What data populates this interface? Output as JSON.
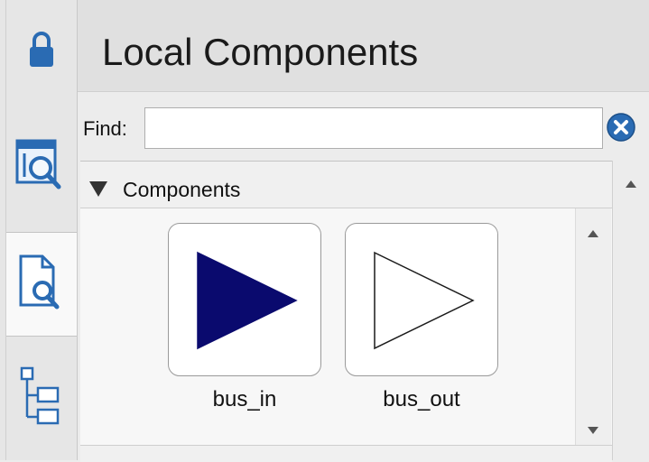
{
  "panel": {
    "title": "Local Components"
  },
  "find": {
    "label": "Find:",
    "value": "",
    "placeholder": ""
  },
  "tree": {
    "group_label": "Components",
    "items": [
      {
        "label": "bus_in",
        "icon": "filled-triangle-right",
        "color": "#0a0a6e"
      },
      {
        "label": "bus_out",
        "icon": "outline-triangle-right",
        "color": "#ffffff"
      }
    ]
  },
  "tabs": [
    {
      "icon": "lock-icon",
      "selected": false
    },
    {
      "icon": "browse-search-icon",
      "selected": false
    },
    {
      "icon": "document-search-icon",
      "selected": true
    },
    {
      "icon": "hierarchy-tree-icon",
      "selected": false
    }
  ],
  "colors": {
    "accent": "#2a6bb3",
    "bus_in_fill": "#0a0a6e"
  }
}
